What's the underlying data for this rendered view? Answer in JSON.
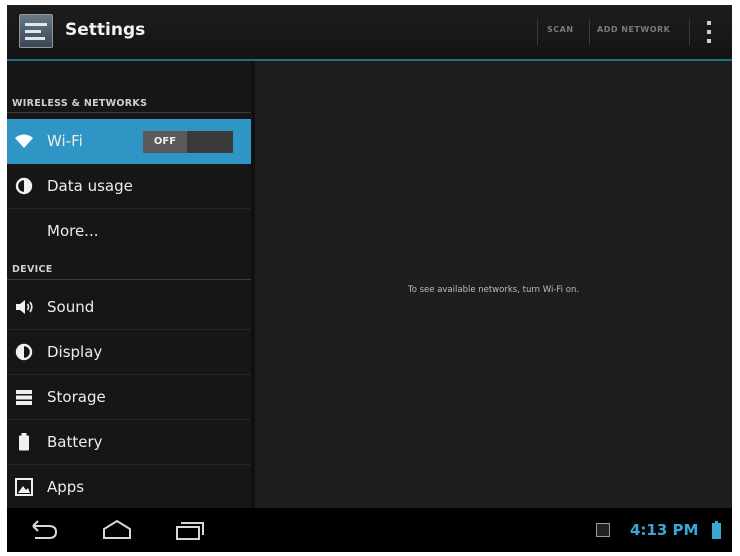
{
  "actionbar": {
    "title": "Settings",
    "actions": [
      "SCAN",
      "ADD NETWORK"
    ],
    "overflow_icon": "overflow-menu-icon"
  },
  "sidebar": {
    "sections": [
      {
        "header": "WIRELESS & NETWORKS",
        "items": [
          {
            "label": "Wi-Fi",
            "icon": "wifi-icon",
            "selected": true,
            "toggle": "OFF"
          },
          {
            "label": "Data usage",
            "icon": "data-usage-icon"
          },
          {
            "label": "More...",
            "icon": ""
          }
        ]
      },
      {
        "header": "DEVICE",
        "items": [
          {
            "label": "Sound",
            "icon": "speaker-icon"
          },
          {
            "label": "Display",
            "icon": "display-icon"
          },
          {
            "label": "Storage",
            "icon": "storage-icon"
          },
          {
            "label": "Battery",
            "icon": "battery-icon"
          },
          {
            "label": "Apps",
            "icon": "apps-icon"
          }
        ]
      }
    ]
  },
  "content": {
    "message": "To see available networks, turn Wi-Fi on."
  },
  "systembar": {
    "time": "4:13 PM"
  },
  "colors": {
    "accent": "#2f95c5",
    "clock": "#39a8d6",
    "divider": "#1f6f86"
  }
}
